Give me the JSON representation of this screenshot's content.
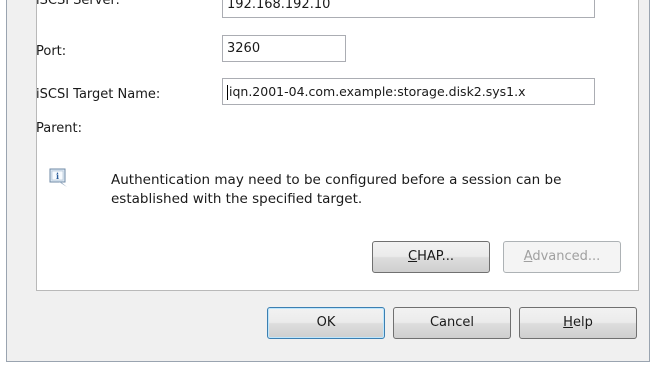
{
  "form": {
    "server_label": "iSCSI Server:",
    "server_value": "192.168.192.10",
    "port_label": "Port:",
    "port_value": "3260",
    "target_label": "iSCSI Target Name:",
    "target_value": "iqn.2001-04.com.example:storage.disk2.sys1.x",
    "parent_label": "Parent:"
  },
  "info": {
    "icon": "info-icon",
    "text": "Authentication may need to be configured before a session can be established with the specified target."
  },
  "buttons": {
    "chap": {
      "accel": "C",
      "rest": "HAP..."
    },
    "advanced": {
      "accel": "A",
      "rest": "dvanced..."
    },
    "ok": "OK",
    "cancel": "Cancel",
    "help": {
      "accel": "H",
      "rest": "elp"
    }
  },
  "colors": {
    "dialog_bg": "#f0f0f0",
    "panel_bg": "#ffffff",
    "field_border": "#abadb3",
    "disabled_text": "#a0a0a0"
  }
}
